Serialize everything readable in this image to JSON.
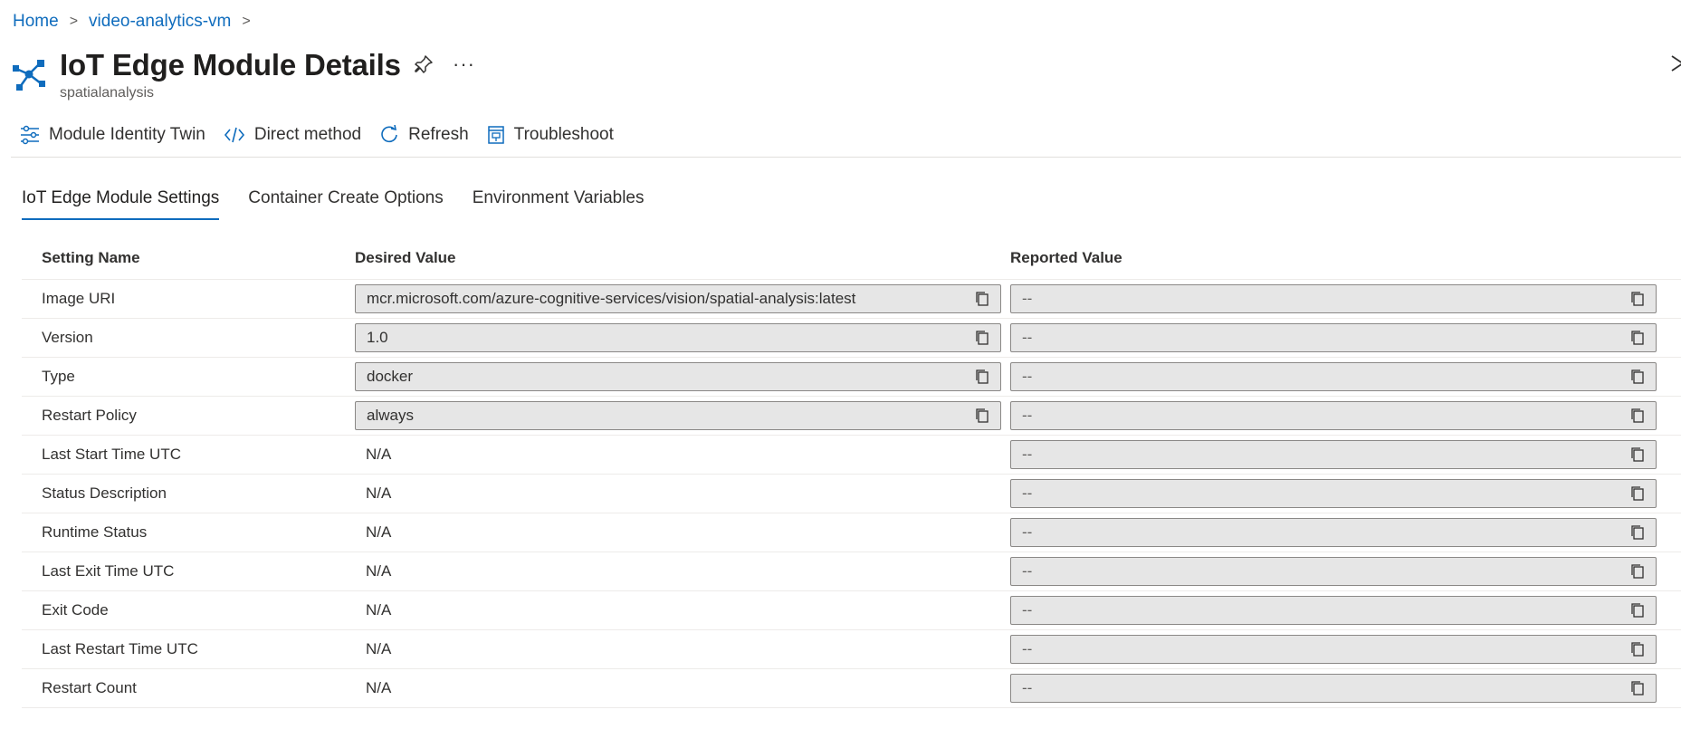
{
  "breadcrumb": {
    "home": "Home",
    "vm": "video-analytics-vm"
  },
  "header": {
    "title": "IoT Edge Module Details",
    "subtitle": "spatialanalysis",
    "more": "···"
  },
  "toolbar": {
    "identity_twin": "Module Identity Twin",
    "direct_method": "Direct method",
    "refresh": "Refresh",
    "troubleshoot": "Troubleshoot"
  },
  "tabs": [
    "IoT Edge Module Settings",
    "Container Create Options",
    "Environment Variables"
  ],
  "table": {
    "headers": [
      "Setting Name",
      "Desired Value",
      "Reported Value"
    ],
    "rows": [
      {
        "name": "Image URI",
        "desired": "mcr.microsoft.com/azure-cognitive-services/vision/spatial-analysis:latest",
        "reported": "--"
      },
      {
        "name": "Version",
        "desired": "1.0",
        "reported": "--"
      },
      {
        "name": "Type",
        "desired": "docker",
        "reported": "--"
      },
      {
        "name": "Restart Policy",
        "desired": "always",
        "reported": "--"
      },
      {
        "name": "Last Start Time UTC",
        "desired": "N/A",
        "reported": "--"
      },
      {
        "name": "Status Description",
        "desired": "N/A",
        "reported": "--"
      },
      {
        "name": "Runtime Status",
        "desired": "N/A",
        "reported": "--"
      },
      {
        "name": "Last Exit Time UTC",
        "desired": "N/A",
        "reported": "--"
      },
      {
        "name": "Exit Code",
        "desired": "N/A",
        "reported": "--"
      },
      {
        "name": "Last Restart Time UTC",
        "desired": "N/A",
        "reported": "--"
      },
      {
        "name": "Restart Count",
        "desired": "N/A",
        "reported": "--"
      }
    ]
  },
  "colors": {
    "accent": "#0f6cbd",
    "field_bg": "#e6e6e6"
  }
}
